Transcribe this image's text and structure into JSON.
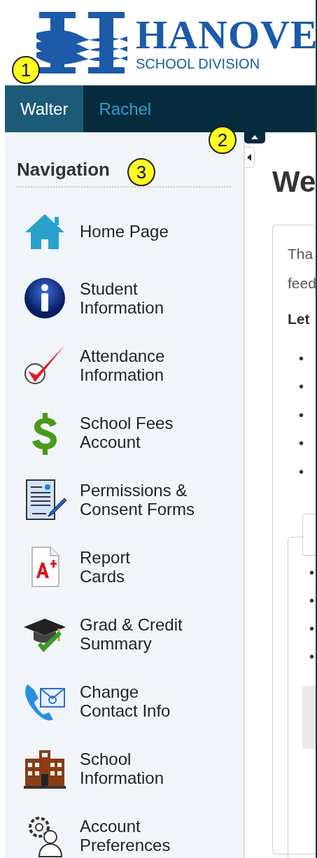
{
  "logo": {
    "name": "HANOVE",
    "subtitle": "SCHOOL DIVISION"
  },
  "tabs": [
    {
      "label": "Walter",
      "selected": true
    },
    {
      "label": "Rachel",
      "selected": false
    }
  ],
  "sidebar": {
    "title": "Navigation",
    "items": [
      {
        "label": "Home Page"
      },
      {
        "label": "Student\nInformation"
      },
      {
        "label": "Attendance\nInformation"
      },
      {
        "label": "School Fees\nAccount"
      },
      {
        "label": "Permissions &\nConsent Forms"
      },
      {
        "label": "Report\nCards"
      },
      {
        "label": "Grad & Credit\nSummary"
      },
      {
        "label": "Change\nContact Info"
      },
      {
        "label": "School\nInformation"
      },
      {
        "label": "Account\nPreferences"
      }
    ]
  },
  "main": {
    "heading": "We",
    "paragraph_lines": [
      "Tha",
      "feed"
    ],
    "subheading": "Let",
    "bullets": [
      "•",
      "•",
      "•",
      "•",
      "•"
    ],
    "inner_bullets": [
      "•",
      "•",
      "•",
      "•"
    ]
  },
  "annotations": [
    {
      "number": "1"
    },
    {
      "number": "2"
    },
    {
      "number": "3"
    }
  ]
}
